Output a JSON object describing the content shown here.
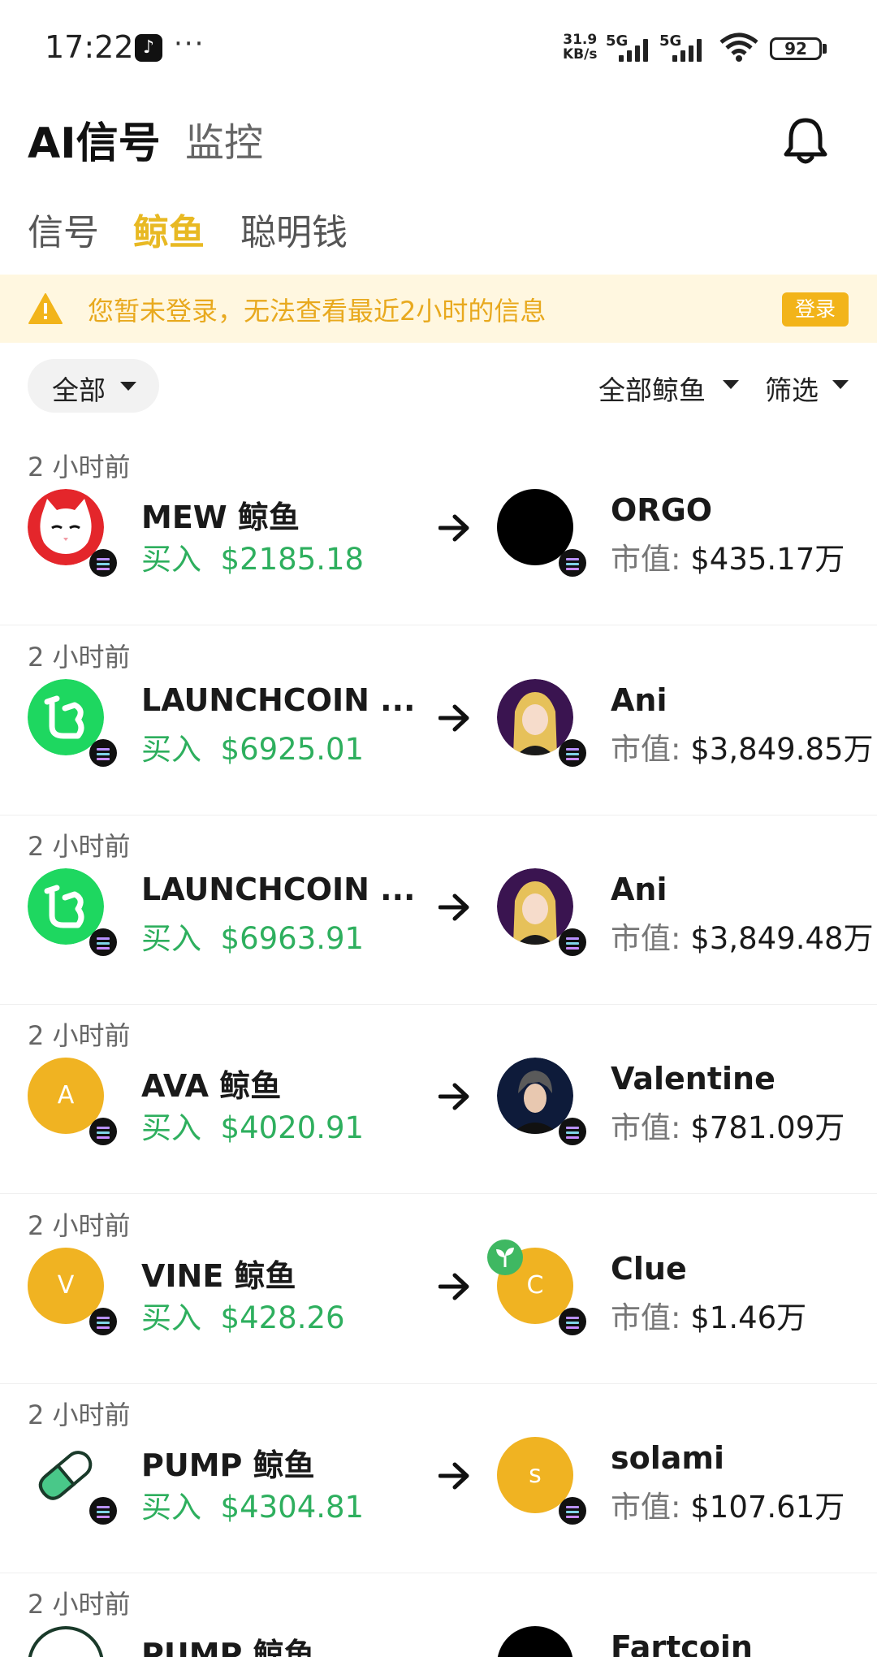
{
  "status_bar": {
    "time": "17:22",
    "speed_top": "31.9",
    "speed_bottom": "KB/s",
    "network_1": "5G",
    "network_2": "5G",
    "wifi_sub": "6",
    "battery": "92"
  },
  "header": {
    "title": "AI信号",
    "subtitle": "监控"
  },
  "tabs": [
    {
      "label": "信号",
      "active": false
    },
    {
      "label": "鲸鱼",
      "active": true
    },
    {
      "label": "聪明钱",
      "active": false
    }
  ],
  "notice": {
    "text": "您暂未登录，无法查看最近2小时的信息",
    "login_label": "登录"
  },
  "filters": {
    "all_label": "全部",
    "whale_label": "全部鲸鱼",
    "screen_label": "筛选"
  },
  "feed": [
    {
      "time": "2 小时前",
      "from_name": "MEW 鲸鱼",
      "from_icon": "mew-cat-icon",
      "action": "买入",
      "amount": "$2185.18",
      "to_name": "ORGO",
      "to_icon": "orgo-black-icon",
      "mc_label": "市值:",
      "mc_value": "$435.17万"
    },
    {
      "time": "2 小时前",
      "from_name": "LAUNCHCOIN ...",
      "from_icon": "launchcoin-icon",
      "action": "买入",
      "amount": "$6925.01",
      "to_name": "Ani",
      "to_icon": "ani-avatar-icon",
      "mc_label": "市值:",
      "mc_value": "$3,849.85万"
    },
    {
      "time": "2 小时前",
      "from_name": "LAUNCHCOIN ...",
      "from_icon": "launchcoin-icon",
      "action": "买入",
      "amount": "$6963.91",
      "to_name": "Ani",
      "to_icon": "ani-avatar-icon",
      "mc_label": "市值:",
      "mc_value": "$3,849.48万"
    },
    {
      "time": "2 小时前",
      "from_name": "AVA 鲸鱼",
      "from_icon": "letter-a-icon",
      "from_letter": "A",
      "action": "买入",
      "amount": "$4020.91",
      "to_name": "Valentine",
      "to_icon": "valentine-avatar-icon",
      "mc_label": "市值:",
      "mc_value": "$781.09万"
    },
    {
      "time": "2 小时前",
      "from_name": "VINE 鲸鱼",
      "from_icon": "letter-v-icon",
      "from_letter": "V",
      "action": "买入",
      "amount": "$428.26",
      "to_name": "Clue",
      "to_icon": "letter-c-icon",
      "to_letter": "C",
      "mc_label": "市值:",
      "mc_value": "$1.46万"
    },
    {
      "time": "2 小时前",
      "from_name": "PUMP 鲸鱼",
      "from_icon": "pill-icon",
      "action": "买入",
      "amount": "$4304.81",
      "to_name": "solami",
      "to_icon": "letter-s-icon",
      "to_letter": "s",
      "mc_label": "市值:",
      "mc_value": "$107.61万"
    },
    {
      "time": "2 小时前",
      "from_name": "PUMP 鲸鱼",
      "to_name": "Fartcoin"
    }
  ],
  "colors": {
    "accent": "#E8B923",
    "buy_green": "#2EAF5E",
    "notice_bg": "#FFF7E0",
    "notice_text": "#E8A91E",
    "coin_yellow": "#F0B322"
  }
}
